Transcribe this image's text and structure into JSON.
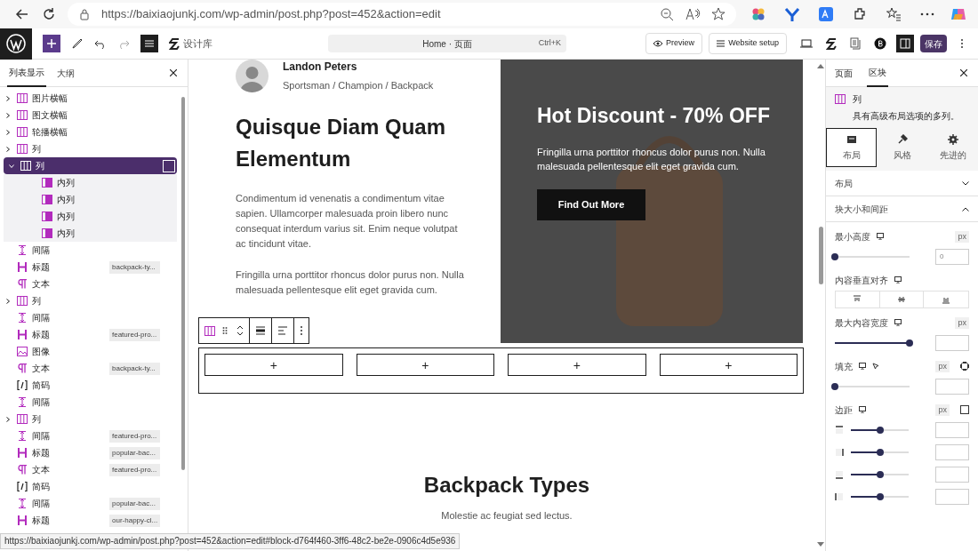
{
  "browser": {
    "url": "https://baixiaojunkj.com/wp-admin/post.php?post=452&action=edit"
  },
  "toolbar": {
    "library_label": "设计库",
    "command_bar": "Home · 页面",
    "shortcut": "Ctrl+K",
    "preview": "Preview",
    "website_setup": "Website setup",
    "save": "保存"
  },
  "list_view": {
    "tabs": [
      {
        "label": "列表显示",
        "selected": true
      },
      {
        "label": "大纲",
        "selected": false
      }
    ],
    "items": [
      {
        "kind": "columns",
        "label": "图片横幅",
        "expanded": false,
        "selected": false
      },
      {
        "kind": "columns",
        "label": "图文横幅",
        "expanded": false,
        "selected": false
      },
      {
        "kind": "columns",
        "label": "轮播横幅",
        "expanded": false,
        "selected": false
      },
      {
        "kind": "columns",
        "label": "列",
        "expanded": false,
        "selected": false
      },
      {
        "kind": "columns",
        "label": "列",
        "expanded": true,
        "selected": true,
        "children": [
          {
            "kind": "column",
            "label": "内列",
            "selected": false
          },
          {
            "kind": "column",
            "label": "内列",
            "selected": false
          },
          {
            "kind": "column",
            "label": "内列",
            "selected": false
          },
          {
            "kind": "column",
            "label": "内列",
            "selected": false
          }
        ]
      },
      {
        "kind": "spacer",
        "label": "间隔",
        "selected": false
      },
      {
        "kind": "heading",
        "label": "标题",
        "tag": "backpack-ty...",
        "selected": false
      },
      {
        "kind": "text",
        "label": "文本",
        "selected": false
      },
      {
        "kind": "columns",
        "label": "列",
        "expanded": false,
        "selected": false
      },
      {
        "kind": "spacer",
        "label": "间隔",
        "selected": false
      },
      {
        "kind": "heading",
        "label": "标题",
        "tag": "featured-pro...",
        "selected": false
      },
      {
        "kind": "image",
        "label": "图像",
        "selected": false
      },
      {
        "kind": "text",
        "label": "文本",
        "tag": "backpack-ty...",
        "selected": false
      },
      {
        "kind": "shortcode",
        "label": "简码",
        "selected": false
      },
      {
        "kind": "spacer",
        "label": "间隔",
        "selected": false
      },
      {
        "kind": "columns",
        "label": "列",
        "expanded": false,
        "selected": false
      },
      {
        "kind": "spacer",
        "label": "间隔",
        "tag": "featured-pro...",
        "selected": false
      },
      {
        "kind": "heading",
        "label": "标题",
        "tag": "popular-bac...",
        "selected": false
      },
      {
        "kind": "text",
        "label": "文本",
        "tag": "featured-pro...",
        "selected": false
      },
      {
        "kind": "shortcode",
        "label": "简码",
        "selected": false
      },
      {
        "kind": "spacer",
        "label": "间隔",
        "tag": "popular-bac...",
        "selected": false
      },
      {
        "kind": "heading",
        "label": "标题",
        "tag": "our-happy-cl...",
        "selected": false
      }
    ]
  },
  "canvas": {
    "author_name": "Landon Peters",
    "author_role": "Sportsman / Champion / Backpack",
    "heading": "Quisque Diam Quam Elementum",
    "paragraphs": [
      "Condimentum id venenatis a condimentum vitae sapien. Ullamcorper malesuada proin libero nunc consequat interdum varius sit. Enim neque volutpat ac tincidunt vitae.",
      "Fringilla urna porttitor rhoncus dolor purus non. Nulla malesuada pellentesque elit eget gravida cum."
    ],
    "promo": {
      "title": "Hot Discount - 70% OFF",
      "text": "Fringilla urna porttitor rhoncus dolor purus non. Nulla malesuada pellentesque elit eget gravida cum.",
      "button": "Find Out More"
    },
    "add_buttons": [
      "+",
      "+",
      "+",
      "+"
    ],
    "section_title": "Backpack Types",
    "section_subtitle": "Molestie ac feugiat sed lectus."
  },
  "settings": {
    "tabs": [
      {
        "label": "页面",
        "selected": false
      },
      {
        "label": "区块",
        "selected": true
      }
    ],
    "block_name": "列",
    "block_description": "具有高级布局选项的多列。",
    "subtabs": [
      {
        "label": "布局",
        "selected": true
      },
      {
        "label": "风格",
        "selected": false
      },
      {
        "label": "先进的",
        "selected": false
      }
    ],
    "panels": [
      {
        "title": "布局",
        "expanded": false
      },
      {
        "title": "块大小和间距",
        "expanded": true
      }
    ],
    "min_height": {
      "label": "最小高度",
      "unit": "px",
      "level": 0,
      "value": "0"
    },
    "vertical_align": {
      "label": "内容垂直对齐"
    },
    "max_width": {
      "label": "最大内容宽度",
      "unit": "px",
      "level": 1
    },
    "padding": {
      "label": "填充",
      "unit": "px",
      "level": 0
    },
    "margin": {
      "label": "边距",
      "unit": "px",
      "sides": [
        {
          "level": 0.5
        },
        {
          "level": 0.5
        },
        {
          "level": 0.5
        },
        {
          "level": 0.5
        }
      ]
    }
  },
  "status_url": "https://baixiaojunkj.com/wp-admin/post.php?post=452&action=edit#block-d764f460-3ff6-48c2-be2e-0906c4d5e936"
}
